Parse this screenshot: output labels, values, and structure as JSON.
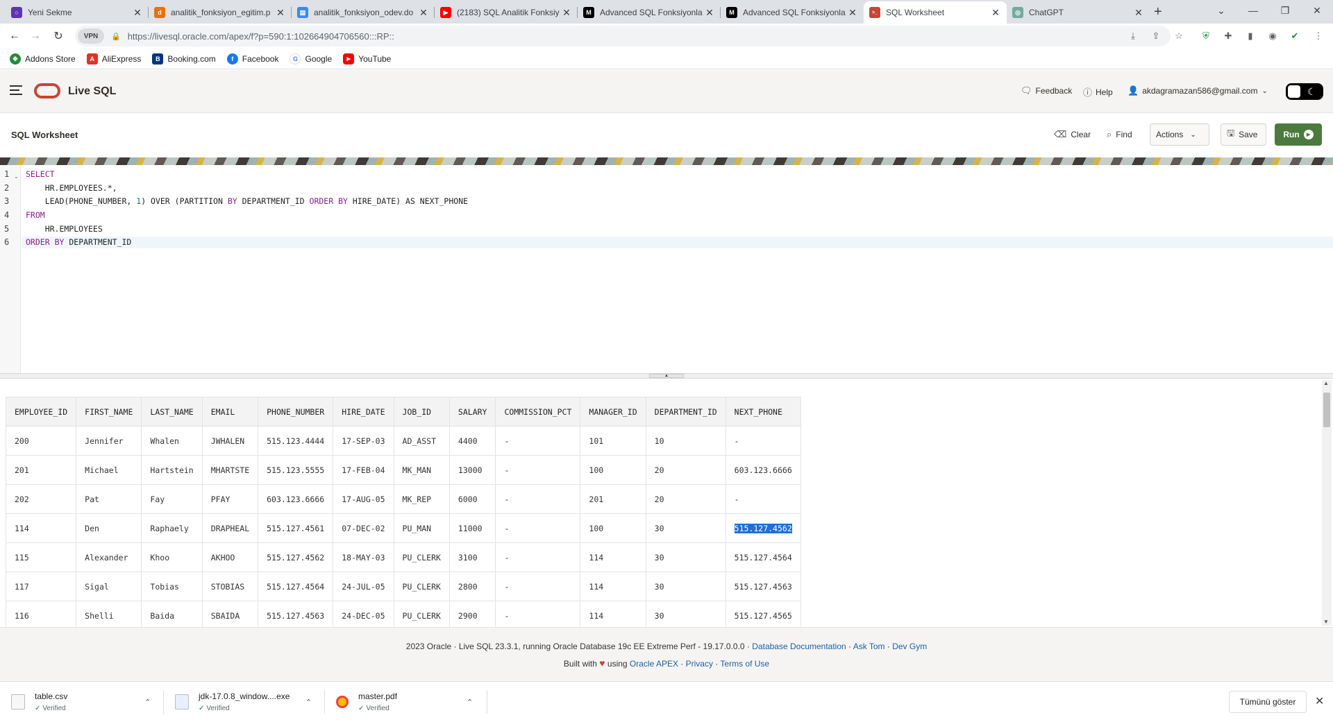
{
  "browser": {
    "tabs": [
      {
        "label": "Yeni Sekme",
        "color": "#5e35b1",
        "glyph": "○"
      },
      {
        "label": "analitik_fonksiyon_egitim.p",
        "color": "#e8710a",
        "glyph": "d"
      },
      {
        "label": "analitik_fonksiyon_odev.do",
        "color": "#4285f4",
        "glyph": "▤"
      },
      {
        "label": "(2183) SQL Analitik Fonksiy",
        "color": "#ff0000",
        "glyph": "▶"
      },
      {
        "label": "Advanced SQL Fonksiyonla",
        "color": "#000000",
        "glyph": "M"
      },
      {
        "label": "Advanced SQL Fonksiyonla",
        "color": "#000000",
        "glyph": "M"
      },
      {
        "label": "SQL Worksheet",
        "color": "#c74634",
        "glyph": ">_"
      },
      {
        "label": "ChatGPT",
        "color": "#74aa9c",
        "glyph": "◎"
      }
    ],
    "url": "https://livesql.oracle.com/apex/f?p=590:1:102664904706560:::RP::",
    "vpn_label": "VPN",
    "bookmarks": [
      {
        "label": "Addons Store",
        "color": "#1e8e3e",
        "glyph": "◆"
      },
      {
        "label": "AliExpress",
        "color": "#e43225",
        "glyph": "A"
      },
      {
        "label": "Booking.com",
        "color": "#003580",
        "glyph": "B"
      },
      {
        "label": "Facebook",
        "color": "#1877f2",
        "glyph": "f"
      },
      {
        "label": "Google",
        "color": "#ffffff",
        "glyph": "G"
      },
      {
        "label": "YouTube",
        "color": "#ff0000",
        "glyph": "▶"
      }
    ]
  },
  "app": {
    "title": "Live SQL",
    "feedback": "Feedback",
    "help": "Help",
    "user": "akdagramazan586@gmail.com"
  },
  "worksheet": {
    "title": "SQL Worksheet",
    "clear": "Clear",
    "find": "Find",
    "actions": "Actions",
    "save": "Save",
    "run": "Run"
  },
  "editor": {
    "line_numbers": [
      "1",
      "2",
      "3",
      "4",
      "5",
      "6"
    ]
  },
  "results": {
    "columns": [
      "EMPLOYEE_ID",
      "FIRST_NAME",
      "LAST_NAME",
      "EMAIL",
      "PHONE_NUMBER",
      "HIRE_DATE",
      "JOB_ID",
      "SALARY",
      "COMMISSION_PCT",
      "MANAGER_ID",
      "DEPARTMENT_ID",
      "NEXT_PHONE"
    ],
    "rows": [
      [
        "200",
        "Jennifer",
        "Whalen",
        "JWHALEN",
        "515.123.4444",
        "17-SEP-03",
        "AD_ASST",
        "4400",
        "-",
        "101",
        "10",
        " -"
      ],
      [
        "201",
        "Michael",
        "Hartstein",
        "MHARTSTE",
        "515.123.5555",
        "17-FEB-04",
        "MK_MAN",
        "13000",
        "-",
        "100",
        "20",
        "603.123.6666"
      ],
      [
        "202",
        "Pat",
        "Fay",
        "PFAY",
        "603.123.6666",
        "17-AUG-05",
        "MK_REP",
        "6000",
        "-",
        "201",
        "20",
        " -"
      ],
      [
        "114",
        "Den",
        "Raphaely",
        "DRAPHEAL",
        "515.127.4561",
        "07-DEC-02",
        "PU_MAN",
        "11000",
        "-",
        "100",
        "30",
        "515.127.4562"
      ],
      [
        "115",
        "Alexander",
        "Khoo",
        "AKHOO",
        "515.127.4562",
        "18-MAY-03",
        "PU_CLERK",
        "3100",
        "-",
        "114",
        "30",
        "515.127.4564"
      ],
      [
        "117",
        "Sigal",
        "Tobias",
        "STOBIAS",
        "515.127.4564",
        "24-JUL-05",
        "PU_CLERK",
        "2800",
        "-",
        "114",
        "30",
        "515.127.4563"
      ],
      [
        "116",
        "Shelli",
        "Baida",
        "SBAIDA",
        "515.127.4563",
        "24-DEC-05",
        "PU_CLERK",
        "2900",
        "-",
        "114",
        "30",
        "515.127.4565"
      ]
    ]
  },
  "footer": {
    "line1_text": "2023 Oracle · Live SQL 23.3.1, running Oracle Database 19c EE Extreme Perf - 19.17.0.0.0 · ",
    "db_docs": "Database Documentation",
    "ask_tom": "Ask Tom",
    "dev_gym": "Dev Gym",
    "sep": " · ",
    "built_with": "Built with ",
    "using": " using ",
    "apex": "Oracle APEX",
    "privacy": "Privacy",
    "terms": "Terms of Use"
  },
  "downloads": {
    "items": [
      {
        "name": "table.csv",
        "status": "Verified"
      },
      {
        "name": "jdk-17.0.8_window....exe",
        "status": "Verified"
      },
      {
        "name": "master.pdf",
        "status": "Verified"
      }
    ],
    "show_all": "Tümünü göster"
  }
}
